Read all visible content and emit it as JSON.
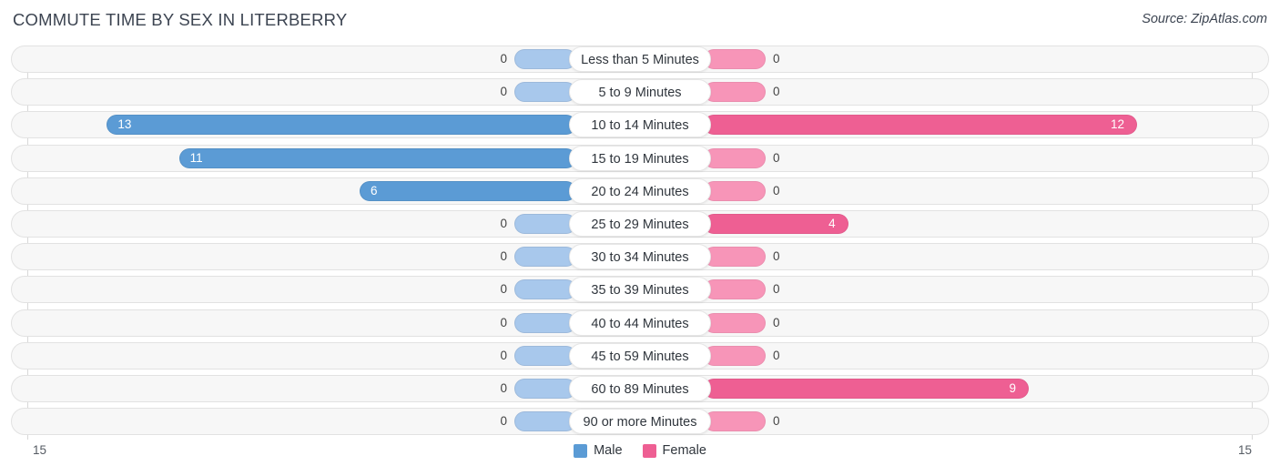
{
  "header": {
    "title": "COMMUTE TIME BY SEX IN LITERBERRY",
    "source": "Source: ZipAtlas.com"
  },
  "legend": {
    "male_label": "Male",
    "female_label": "Female",
    "male_color": "#5B9BD5",
    "female_color": "#EE5F93",
    "male_color_light": "#A8C8EC",
    "female_color_light": "#F795B8"
  },
  "axis": {
    "left_max_label": "15",
    "right_max_label": "15"
  },
  "chart_data": {
    "type": "bar",
    "orientation": "horizontal-diverging",
    "title": "COMMUTE TIME BY SEX IN LITERBERRY",
    "subtitle": "Source: ZipAtlas.com",
    "xlabel": "",
    "ylabel": "",
    "xlim": [
      15,
      15
    ],
    "grid": false,
    "legend_position": "bottom-center",
    "categories": [
      "Less than 5 Minutes",
      "5 to 9 Minutes",
      "10 to 14 Minutes",
      "15 to 19 Minutes",
      "20 to 24 Minutes",
      "25 to 29 Minutes",
      "30 to 34 Minutes",
      "35 to 39 Minutes",
      "40 to 44 Minutes",
      "45 to 59 Minutes",
      "60 to 89 Minutes",
      "90 or more Minutes"
    ],
    "series": [
      {
        "name": "Male",
        "values": [
          0,
          0,
          13,
          11,
          6,
          0,
          0,
          0,
          0,
          0,
          0,
          0
        ],
        "labels": [
          "0",
          "0",
          "13",
          "11",
          "6",
          "0",
          "0",
          "0",
          "0",
          "0",
          "0",
          "0"
        ]
      },
      {
        "name": "Female",
        "values": [
          0,
          0,
          12,
          0,
          0,
          4,
          0,
          0,
          0,
          0,
          9,
          0
        ],
        "labels": [
          "0",
          "0",
          "12",
          "0",
          "0",
          "4",
          "0",
          "0",
          "0",
          "0",
          "9",
          "0"
        ]
      }
    ]
  }
}
